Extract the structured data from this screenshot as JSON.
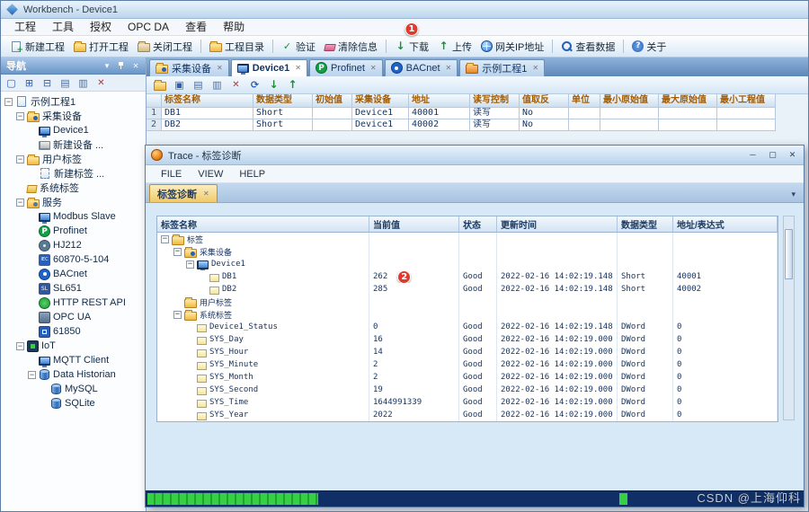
{
  "title_bar": {
    "title": "Workbench - Device1"
  },
  "menu_bar": {
    "items": [
      "工程",
      "工具",
      "授权",
      "OPC DA",
      "查看",
      "帮助"
    ]
  },
  "toolbar": {
    "items": [
      {
        "id": "new-project",
        "label": "新建工程",
        "icon": "page-new"
      },
      {
        "id": "open-project",
        "label": "打开工程",
        "icon": "folder-open"
      },
      {
        "id": "close-project",
        "label": "关闭工程",
        "icon": "folder-close",
        "sep_after": true
      },
      {
        "id": "project-directory",
        "label": "工程目录",
        "icon": "folder",
        "sep_after": true
      },
      {
        "id": "validate",
        "label": "验证",
        "icon": "check"
      },
      {
        "id": "clear-info",
        "label": "清除信息",
        "icon": "eraser",
        "sep_after": true
      },
      {
        "id": "download",
        "label": "下载",
        "icon": "arrow-down",
        "badge": "1"
      },
      {
        "id": "upload",
        "label": "上传",
        "icon": "arrow-up"
      },
      {
        "id": "gateway-ip",
        "label": "网关IP地址",
        "icon": "globe",
        "sep_after": true
      },
      {
        "id": "view-data",
        "label": "查看数据",
        "icon": "search",
        "sep_after": true
      },
      {
        "id": "about",
        "label": "关于",
        "icon": "question"
      }
    ]
  },
  "nav": {
    "title": "导航",
    "toolbar_icons": [
      "new-item",
      "new-folder",
      "expand-tree",
      "copy",
      "paste",
      "delete"
    ],
    "tree": [
      {
        "indent": 0,
        "expand": "-",
        "icon": "doc",
        "label": "示例工程1"
      },
      {
        "indent": 1,
        "expand": "-",
        "icon": "folder-cam",
        "label": "采集设备"
      },
      {
        "indent": 2,
        "icon": "device",
        "label": "Device1"
      },
      {
        "indent": 2,
        "icon": "device-new",
        "label": "新建设备 ..."
      },
      {
        "indent": 1,
        "expand": "-",
        "icon": "folder",
        "label": "用户标签"
      },
      {
        "indent": 2,
        "icon": "tag-new",
        "label": "新建标签 ..."
      },
      {
        "indent": 1,
        "icon": "tags",
        "label": "系统标签"
      },
      {
        "indent": 1,
        "expand": "-",
        "icon": "folder-gear",
        "label": "服务"
      },
      {
        "indent": 2,
        "icon": "device",
        "label": "Modbus Slave"
      },
      {
        "indent": 2,
        "icon": "profinet",
        "label": "Profinet"
      },
      {
        "indent": 2,
        "icon": "hj",
        "label": "HJ212"
      },
      {
        "indent": 2,
        "icon": "iec",
        "label": "60870-5-104"
      },
      {
        "indent": 2,
        "icon": "bacnet",
        "label": "BACnet"
      },
      {
        "indent": 2,
        "icon": "sl",
        "label": "SL651"
      },
      {
        "indent": 2,
        "icon": "http",
        "label": "HTTP REST API"
      },
      {
        "indent": 2,
        "icon": "opc",
        "label": "OPC UA"
      },
      {
        "indent": 2,
        "icon": "i61850",
        "label": "61850"
      },
      {
        "indent": 1,
        "expand": "-",
        "icon": "iot",
        "label": "IoT"
      },
      {
        "indent": 2,
        "icon": "device",
        "label": "MQTT Client"
      },
      {
        "indent": 2,
        "expand": "-",
        "icon": "db",
        "label": "Data Historian"
      },
      {
        "indent": 3,
        "icon": "db",
        "label": "MySQL"
      },
      {
        "indent": 3,
        "icon": "db",
        "label": "SQLite"
      }
    ]
  },
  "doc_tabs": [
    {
      "label": "采集设备",
      "icon": "folder-cam",
      "active": false
    },
    {
      "label": "Device1",
      "icon": "device",
      "active": true
    },
    {
      "label": "Profinet",
      "icon": "profinet",
      "active": false
    },
    {
      "label": "BACnet",
      "icon": "bacnet",
      "active": false
    },
    {
      "label": "示例工程1",
      "icon": "book",
      "active": false
    }
  ],
  "doc_toolbar": [
    "folder",
    "save",
    "copy",
    "paste",
    "delete",
    "refresh",
    "arrow-down",
    "arrow-up"
  ],
  "tag_grid": {
    "headers": [
      "标签名称",
      "数据类型",
      "初始值",
      "采集设备",
      "地址",
      "读写控制",
      "值取反",
      "单位",
      "最小原始值",
      "最大原始值",
      "最小工程值"
    ],
    "rows": [
      {
        "num": "1",
        "cells": [
          "DB1",
          "Short",
          "",
          "Device1",
          "40001",
          "读写",
          "No",
          "",
          "",
          "",
          ""
        ]
      },
      {
        "num": "2",
        "cells": [
          "DB2",
          "Short",
          "",
          "Device1",
          "40002",
          "读写",
          "No",
          "",
          "",
          "",
          ""
        ]
      }
    ]
  },
  "trace": {
    "title": "Trace - 标签诊断",
    "menu": [
      "FILE",
      "VIEW",
      "HELP"
    ],
    "tab": "标签诊断",
    "grid_headers": [
      "标签名称",
      "当前值",
      "状态",
      "更新时间",
      "数据类型",
      "地址/表达式"
    ],
    "rows": [
      {
        "indent": 0,
        "expand": "-",
        "icon": "folder",
        "name": "标签",
        "value": "",
        "status": "",
        "time": "",
        "dtype": "",
        "addr": ""
      },
      {
        "indent": 1,
        "expand": "-",
        "icon": "folder-cam",
        "name": "采集设备",
        "value": "",
        "status": "",
        "time": "",
        "dtype": "",
        "addr": ""
      },
      {
        "indent": 2,
        "expand": "-",
        "icon": "device",
        "name": "Device1",
        "value": "",
        "status": "",
        "time": "",
        "dtype": "",
        "addr": ""
      },
      {
        "indent": 3,
        "icon": "tag",
        "name": "DB1",
        "value": "262",
        "badge": "2",
        "status": "Good",
        "time": "2022-02-16 14:02:19.148",
        "dtype": "Short",
        "addr": "40001"
      },
      {
        "indent": 3,
        "icon": "tag",
        "name": "DB2",
        "value": "285",
        "status": "Good",
        "time": "2022-02-16 14:02:19.148",
        "dtype": "Short",
        "addr": "40002"
      },
      {
        "indent": 1,
        "icon": "folder",
        "name": "用户标签",
        "value": "",
        "status": "",
        "time": "",
        "dtype": "",
        "addr": ""
      },
      {
        "indent": 1,
        "expand": "-",
        "icon": "folder",
        "name": "系统标签",
        "value": "",
        "status": "",
        "time": "",
        "dtype": "",
        "addr": ""
      },
      {
        "indent": 2,
        "icon": "tag",
        "name": "Device1_Status",
        "value": "0",
        "status": "Good",
        "time": "2022-02-16 14:02:19.148",
        "dtype": "DWord",
        "addr": "0"
      },
      {
        "indent": 2,
        "icon": "tag",
        "name": "SYS_Day",
        "value": "16",
        "status": "Good",
        "time": "2022-02-16 14:02:19.000",
        "dtype": "DWord",
        "addr": "0"
      },
      {
        "indent": 2,
        "icon": "tag",
        "name": "SYS_Hour",
        "value": "14",
        "status": "Good",
        "time": "2022-02-16 14:02:19.000",
        "dtype": "DWord",
        "addr": "0"
      },
      {
        "indent": 2,
        "icon": "tag",
        "name": "SYS_Minute",
        "value": "2",
        "status": "Good",
        "time": "2022-02-16 14:02:19.000",
        "dtype": "DWord",
        "addr": "0"
      },
      {
        "indent": 2,
        "icon": "tag",
        "name": "SYS_Month",
        "value": "2",
        "status": "Good",
        "time": "2022-02-16 14:02:19.000",
        "dtype": "DWord",
        "addr": "0"
      },
      {
        "indent": 2,
        "icon": "tag",
        "name": "SYS_Second",
        "value": "19",
        "status": "Good",
        "time": "2022-02-16 14:02:19.000",
        "dtype": "DWord",
        "addr": "0"
      },
      {
        "indent": 2,
        "icon": "tag",
        "name": "SYS_Time",
        "value": "1644991339",
        "status": "Good",
        "time": "2022-02-16 14:02:19.000",
        "dtype": "DWord",
        "addr": "0"
      },
      {
        "indent": 2,
        "icon": "tag",
        "name": "SYS_Year",
        "value": "2022",
        "status": "Good",
        "time": "2022-02-16 14:02:19.000",
        "dtype": "DWord",
        "addr": "0"
      }
    ]
  },
  "progress": {
    "percent": 26,
    "chip_left_percent": 72
  },
  "watermark": "CSDN @上海仰科",
  "colors": {
    "badge_red": "#e03a2f",
    "progress_green": "#35d044",
    "header_orange": "#a35b00",
    "grid_text_navy": "#14325f",
    "titlebar_blue": "#bcd6ee"
  }
}
